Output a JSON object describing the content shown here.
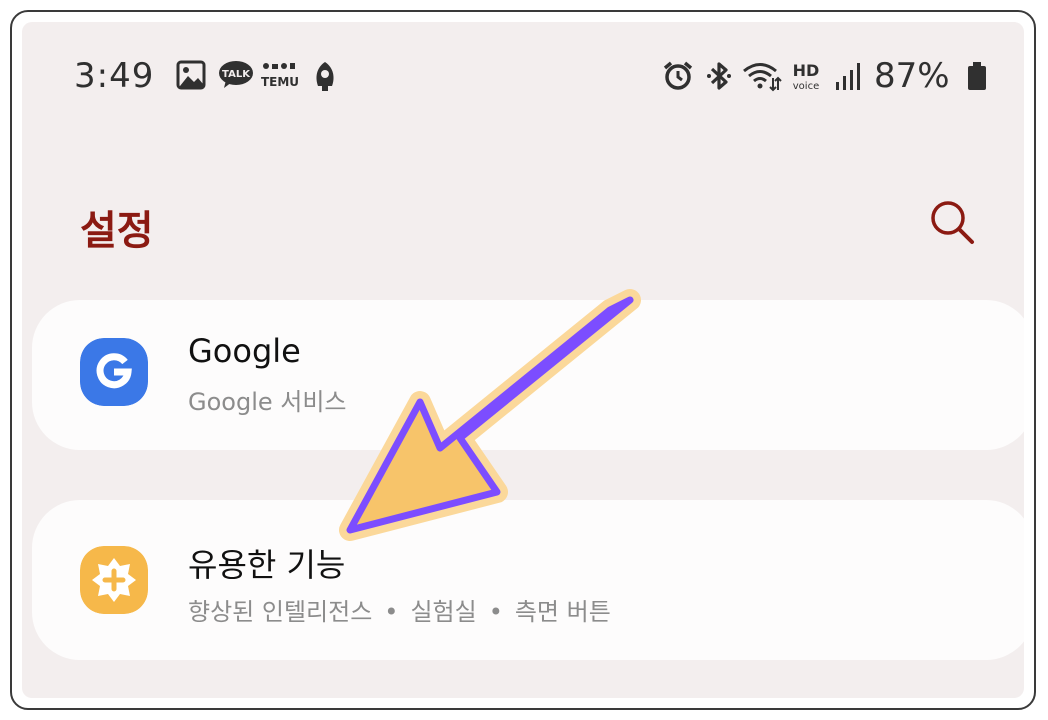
{
  "status_bar": {
    "time": "3:49",
    "notification_icons": [
      "gallery-icon",
      "kakaotalk-icon",
      "temu-icon",
      "rocket-app-icon"
    ],
    "talk_label": "TALK",
    "temu_label": "TEMU",
    "system_icons": [
      "alarm-icon",
      "bluetooth-icon",
      "wifi-icon",
      "hd-voice-icon",
      "signal-icon",
      "battery-icon"
    ],
    "hd_label": "HD",
    "voice_label": "voice",
    "battery": "87%"
  },
  "header": {
    "title": "설정",
    "search_icon": "search-icon",
    "accent_color": "#8b1a12"
  },
  "items": [
    {
      "title": "Google",
      "subtitle": "Google 서비스",
      "icon": "google-icon",
      "icon_color": "#3b78e7"
    },
    {
      "title": "유용한 기능",
      "subtitle_parts": [
        "향상된 인텔리전스",
        "실험실",
        "측면 버튼"
      ],
      "separator": "•",
      "icon": "advanced-features-icon",
      "icon_color": "#f6b84a"
    }
  ],
  "annotation": {
    "type": "arrow",
    "fill_color": "#f7c46a",
    "stroke_color": "#7c4dff"
  }
}
